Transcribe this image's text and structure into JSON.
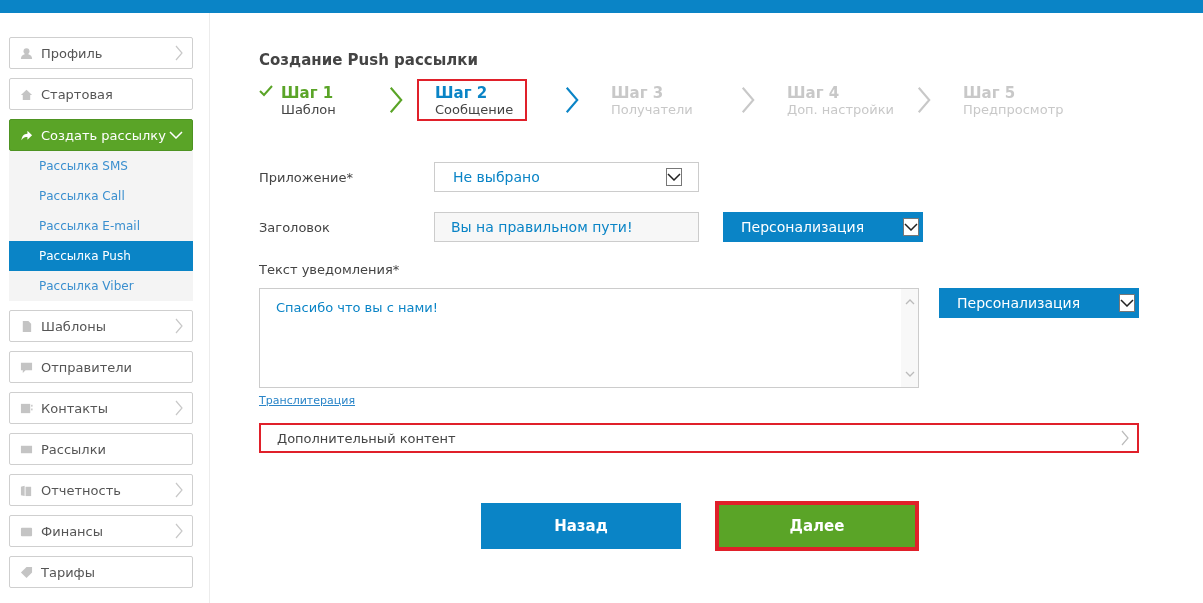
{
  "sidebar": {
    "items": [
      {
        "label": "Профиль",
        "kind": "submenu",
        "selected": false
      },
      {
        "label": "Стартовая",
        "kind": "link",
        "selected": false
      },
      {
        "label": "Создать рассылку",
        "kind": "dropdown",
        "selected": true,
        "expanded": true,
        "children": [
          {
            "label": "Рассылка SMS",
            "selected": false
          },
          {
            "label": "Рассылка Call",
            "selected": false
          },
          {
            "label": "Рассылка E-mail",
            "selected": false
          },
          {
            "label": "Рассылка Push",
            "selected": true
          },
          {
            "label": "Рассылка Viber",
            "selected": false
          }
        ]
      },
      {
        "label": "Шаблоны",
        "kind": "submenu",
        "selected": false
      },
      {
        "label": "Отправители",
        "kind": "link",
        "selected": false
      },
      {
        "label": "Контакты",
        "kind": "submenu",
        "selected": false
      },
      {
        "label": "Рассылки",
        "kind": "link",
        "selected": false
      },
      {
        "label": "Отчетность",
        "kind": "submenu",
        "selected": false
      },
      {
        "label": "Финансы",
        "kind": "submenu",
        "selected": false
      },
      {
        "label": "Тарифы",
        "kind": "link",
        "selected": false
      }
    ]
  },
  "page_title": "Создание Push рассылки",
  "steps": [
    {
      "title": "Шаг 1",
      "subtitle": "Шаблон",
      "kind": "done",
      "highlighted": false
    },
    {
      "title": "Шаг 2",
      "subtitle": "Сообщение",
      "kind": "current",
      "highlighted": true
    },
    {
      "title": "Шаг 3",
      "subtitle": "Получатели",
      "kind": "pending",
      "highlighted": false
    },
    {
      "title": "Шаг 4",
      "subtitle": "Доп. настройки",
      "kind": "pending",
      "highlighted": false
    },
    {
      "title": "Шаг 5",
      "subtitle": "Предпросмотр",
      "kind": "pending",
      "highlighted": false
    }
  ],
  "form": {
    "app": {
      "label": "Приложение*",
      "value": "Не выбрано"
    },
    "heading": {
      "label": "Заголовок",
      "value": "Вы на правильном пути!",
      "personalize": "Персонализация"
    },
    "text": {
      "label": "Текст уведомления*",
      "value": "Спасибо что вы с нами!",
      "personalize": "Персонализация",
      "link": "Транслитерация"
    },
    "extra": {
      "label": "Дополнительный контент",
      "expanded": false,
      "highlighted": true
    }
  },
  "buttons": [
    {
      "label": "Назад",
      "kind": "secondary",
      "highlighted": false
    },
    {
      "label": "Далее",
      "kind": "primary",
      "highlighted": true
    }
  ]
}
